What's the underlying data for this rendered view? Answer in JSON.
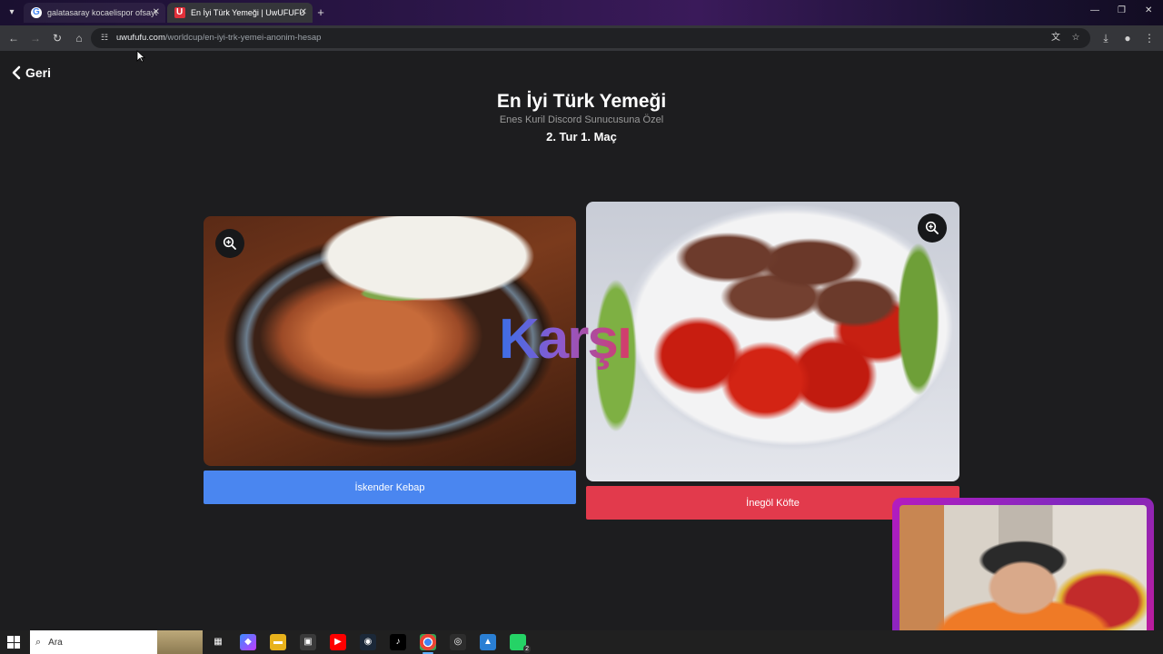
{
  "browser": {
    "tabs": [
      {
        "title": "galatasaray kocaelispor ofsayt",
        "active": false
      },
      {
        "title": "En İyi Türk Yemeği | UwUFUFU",
        "active": true
      }
    ],
    "url_host": "uwufufu.com",
    "url_path": "/worldcup/en-iyi-trk-yemei-anonim-hesap"
  },
  "page": {
    "back_label": "Geri",
    "title": "En İyi Türk Yemeği",
    "subtitle": "Enes Kuril Discord Sunucusuna Özel",
    "round": "2. Tur 1. Maç",
    "vs_label": "Karşı"
  },
  "choices": {
    "left": {
      "label": "İskender Kebap",
      "color": "#4a86f0"
    },
    "right": {
      "label": "İnegöl Köfte",
      "color": "#e23a4c"
    }
  },
  "taskbar": {
    "search_placeholder": "Ara",
    "whatsapp_badge": "2"
  },
  "icons": {
    "zoom": "zoom-in-icon",
    "back": "chevron-left-icon"
  }
}
